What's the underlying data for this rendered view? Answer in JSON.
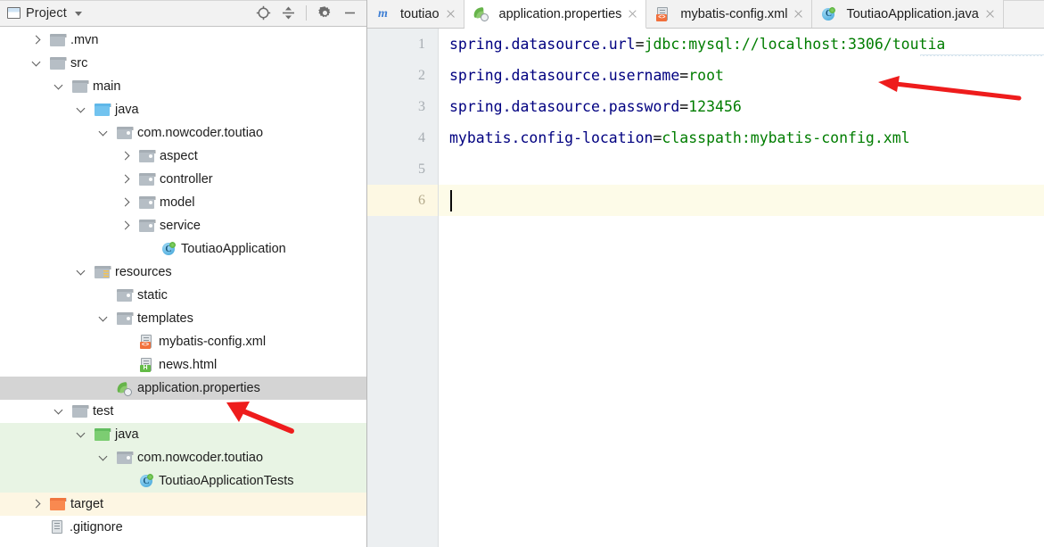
{
  "project_panel": {
    "title": "Project",
    "caret_icon": "chevron-down-icon",
    "project_icon": "project-window-icon",
    "toolbar_buttons": [
      {
        "name": "locate-in-tree-button",
        "icon": "crosshair-target-icon",
        "tooltip": "Select Opened File"
      },
      {
        "name": "collapse-all-button",
        "icon": "collapse-all-icon",
        "tooltip": "Collapse All"
      },
      {
        "name": "settings-button",
        "icon": "gear-icon",
        "tooltip": "Show Options Menu"
      },
      {
        "name": "hide-button",
        "icon": "minimize-icon",
        "tooltip": "Hide"
      }
    ],
    "tree": [
      {
        "label": ".mvn",
        "indent": 1,
        "toggle": "collapsed",
        "icon": "folder-grey-icon",
        "bg": "none"
      },
      {
        "label": "src",
        "indent": 1,
        "toggle": "expanded",
        "icon": "folder-grey-icon",
        "bg": "none"
      },
      {
        "label": "main",
        "indent": 2,
        "toggle": "expanded",
        "icon": "folder-grey-icon",
        "bg": "none"
      },
      {
        "label": "java",
        "indent": 3,
        "toggle": "expanded",
        "icon": "folder-blue-source-root-icon",
        "bg": "none"
      },
      {
        "label": "com.nowcoder.toutiao",
        "indent": 4,
        "toggle": "expanded",
        "icon": "package-icon",
        "bg": "none"
      },
      {
        "label": "aspect",
        "indent": 5,
        "toggle": "collapsed",
        "icon": "package-icon",
        "bg": "none"
      },
      {
        "label": "controller",
        "indent": 5,
        "toggle": "collapsed",
        "icon": "package-icon",
        "bg": "none"
      },
      {
        "label": "model",
        "indent": 5,
        "toggle": "collapsed",
        "icon": "package-icon",
        "bg": "none"
      },
      {
        "label": "service",
        "indent": 5,
        "toggle": "collapsed",
        "icon": "package-icon",
        "bg": "none"
      },
      {
        "label": "ToutiaoApplication",
        "indent": 6,
        "toggle": "none",
        "icon": "java-class-run-icon",
        "bg": "none"
      },
      {
        "label": "resources",
        "indent": 3,
        "toggle": "expanded",
        "icon": "folder-resources-icon",
        "bg": "none"
      },
      {
        "label": "static",
        "indent": 4,
        "toggle": "none",
        "icon": "package-icon",
        "bg": "none"
      },
      {
        "label": "templates",
        "indent": 4,
        "toggle": "expanded",
        "icon": "package-icon",
        "bg": "none"
      },
      {
        "label": "mybatis-config.xml",
        "indent": 5,
        "toggle": "none",
        "icon": "xml-file-icon",
        "bg": "none"
      },
      {
        "label": "news.html",
        "indent": 5,
        "toggle": "none",
        "icon": "html-file-icon",
        "bg": "none"
      },
      {
        "label": "application.properties",
        "indent": 4,
        "toggle": "none",
        "icon": "spring-properties-icon",
        "bg": "selected"
      },
      {
        "label": "test",
        "indent": 2,
        "toggle": "expanded",
        "icon": "folder-grey-icon",
        "bg": "none"
      },
      {
        "label": "java",
        "indent": 3,
        "toggle": "expanded",
        "icon": "folder-green-test-root-icon",
        "bg": "green"
      },
      {
        "label": "com.nowcoder.toutiao",
        "indent": 4,
        "toggle": "expanded",
        "icon": "package-icon",
        "bg": "green"
      },
      {
        "label": "ToutiaoApplicationTests",
        "indent": 5,
        "toggle": "none",
        "icon": "java-class-run-icon",
        "bg": "green"
      },
      {
        "label": "target",
        "indent": 1,
        "toggle": "collapsed",
        "icon": "folder-orange-excluded-icon",
        "bg": "yellow"
      },
      {
        "label": ".gitignore",
        "indent": 1,
        "toggle": "none",
        "icon": "text-file-icon",
        "bg": "none"
      }
    ]
  },
  "editor": {
    "tabs": [
      {
        "label": "toutiao",
        "icon": "maven-module-icon",
        "active": false,
        "closable": true
      },
      {
        "label": "application.properties",
        "icon": "spring-properties-icon",
        "active": true,
        "closable": true
      },
      {
        "label": "mybatis-config.xml",
        "icon": "xml-file-icon",
        "active": false,
        "closable": true
      },
      {
        "label": "ToutiaoApplication.java",
        "icon": "java-class-run-icon",
        "active": false,
        "closable": true
      }
    ],
    "line_numbers": [
      "1",
      "2",
      "3",
      "4",
      "5",
      "6"
    ],
    "current_line": 6,
    "lines": [
      {
        "key": "spring.datasource.url",
        "eq": "=",
        "value": "jdbc:mysql://localhost:3306/toutia",
        "truncated": true
      },
      {
        "key": "spring.datasource.username",
        "eq": "=",
        "value": "root",
        "truncated": false
      },
      {
        "key": "spring.datasource.password",
        "eq": "=",
        "value": "123456",
        "truncated": false
      },
      {
        "key": "mybatis.config-location",
        "eq": "=",
        "value": "classpath:mybatis-config.xml",
        "truncated": false
      },
      {
        "key": "",
        "eq": "",
        "value": "",
        "truncated": false
      },
      {
        "key": "",
        "eq": "",
        "value": "",
        "truncated": false
      }
    ]
  },
  "annotations": [
    {
      "name": "red-arrow-to-code",
      "icon": "arrow-left-icon",
      "points_to": "spring.datasource.username=root"
    },
    {
      "name": "red-arrow-to-properties",
      "icon": "arrow-up-left-icon",
      "points_to": "application.properties"
    }
  ],
  "colors": {
    "key_blue": "#000080",
    "value_green": "#007d00",
    "selection_grey": "#d4d4d4",
    "test_root_green": "#e8f4e4",
    "excluded_yellow": "#fdf6e3",
    "caret_line": "#fdfbe8",
    "annotation_red": "#ee1c1c"
  }
}
